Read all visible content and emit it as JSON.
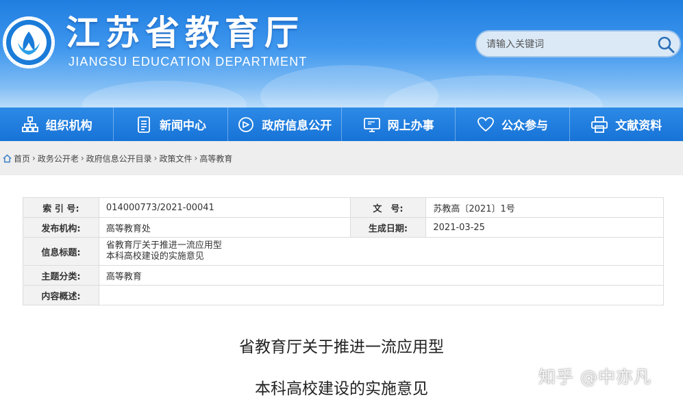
{
  "header": {
    "title": "江苏省教育厅",
    "subtitle": "JIANGSU EDUCATION DEPARTMENT",
    "logo_icon": "jiangsu-education-emblem",
    "search": {
      "placeholder": "请输入关键词",
      "icon": "search-icon"
    }
  },
  "nav": [
    {
      "label": "组织机构",
      "icon": "org-chart-icon"
    },
    {
      "label": "新闻中心",
      "icon": "document-icon"
    },
    {
      "label": "政府信息公开",
      "icon": "eye-icon"
    },
    {
      "label": "网上办事",
      "icon": "monitor-icon"
    },
    {
      "label": "公众参与",
      "icon": "heart-icon"
    },
    {
      "label": "文献资料",
      "icon": "printer-icon"
    }
  ],
  "breadcrumb": {
    "home": "首页",
    "items": [
      "政务公开老",
      "政府信息公开目录",
      "政策文件",
      "高等教育"
    ],
    "separator": "›"
  },
  "meta": {
    "index_label": "索 引 号:",
    "index_value": "014000773/2021-00041",
    "docno_label": "文　号:",
    "docno_value": "苏教高〔2021〕1号",
    "publisher_label": "发布机构:",
    "publisher_value": "高等教育处",
    "date_label": "生成日期:",
    "date_value": "2021-03-25",
    "info_title_label": "信息标题:",
    "info_title_line1": "省教育厅关于推进一流应用型",
    "info_title_line2": "本科高校建设的实施意见",
    "topic_label": "主题分类:",
    "topic_value": "高等教育",
    "summary_label": "内容概述:",
    "summary_value": ""
  },
  "document": {
    "title_line1": "省教育厅关于推进一流应用型",
    "title_line2": "本科高校建设的实施意见"
  },
  "watermark": "知乎 @中亦凡",
  "colors": {
    "header_blue": "#1f7ee0",
    "nav_blue": "#1773d7",
    "breadcrumb_bg": "#eeeeee",
    "label_bg": "#f2f2f2"
  }
}
